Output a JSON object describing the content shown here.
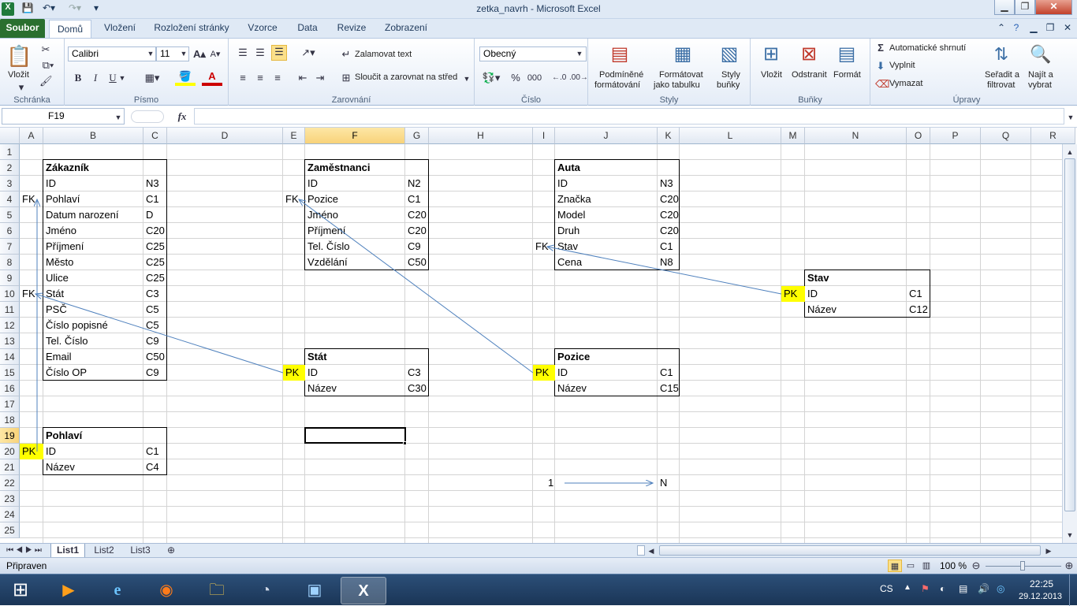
{
  "window": {
    "title": "zetka_navrh  -  Microsoft Excel"
  },
  "quick_access": {
    "app_icon": "excel-icon",
    "save_icon": "save-icon",
    "undo_icon": "undo-icon",
    "redo_icon": "redo-icon"
  },
  "tabs": [
    "Soubor",
    "Domů",
    "Vložení",
    "Rozložení stránky",
    "Vzorce",
    "Data",
    "Revize",
    "Zobrazení"
  ],
  "active_tab": "Domů",
  "ribbon": {
    "clipboard": {
      "paste": "Vložit",
      "group": "Schránka"
    },
    "font": {
      "name": "Calibri",
      "size": "11",
      "bold": "B",
      "italic": "I",
      "underline": "U",
      "group": "Písmo"
    },
    "alignment": {
      "wrap": "Zalamovat text",
      "merge": "Sloučit a zarovnat na střed",
      "group": "Zarovnání"
    },
    "number": {
      "format": "Obecný",
      "percent": "%",
      "thousands": "000",
      "group": "Číslo"
    },
    "styles": {
      "conditional_1": "Podmíněné",
      "conditional_2": "formátování",
      "table_1": "Formátovat",
      "table_2": "jako tabulku",
      "cell_1": "Styly",
      "cell_2": "buňky",
      "group": "Styly"
    },
    "cells": {
      "insert": "Vložit",
      "delete": "Odstranit",
      "format": "Formát",
      "group": "Buňky"
    },
    "editing": {
      "autosum": "Automatické shrnutí",
      "fill": "Vyplnit",
      "clear": "Vymazat",
      "sort_1": "Seřadit a",
      "sort_2": "filtrovat",
      "find_1": "Najít a",
      "find_2": "vybrat",
      "group": "Úpravy"
    }
  },
  "formula_bar": {
    "name_box": "F19",
    "fx": "fx",
    "value": ""
  },
  "columns": [
    "A",
    "B",
    "C",
    "D",
    "E",
    "F",
    "G",
    "H",
    "I",
    "J",
    "K",
    "L",
    "M",
    "N",
    "O",
    "P",
    "Q",
    "R"
  ],
  "rows": [
    "1",
    "2",
    "3",
    "4",
    "5",
    "6",
    "7",
    "8",
    "9",
    "10",
    "11",
    "12",
    "13",
    "14",
    "15",
    "16",
    "17",
    "18",
    "19",
    "20",
    "21",
    "22",
    "23",
    "24",
    "25"
  ],
  "selected_cell": {
    "column": "F",
    "row": "19"
  },
  "tables": {
    "zakaznik": {
      "title": "Zákazník",
      "rows": [
        {
          "key": "",
          "name": "ID",
          "type": "N3"
        },
        {
          "key": "FK",
          "name": "Pohlaví",
          "type": "C1"
        },
        {
          "key": "",
          "name": "Datum narození",
          "type": "D"
        },
        {
          "key": "",
          "name": "Jméno",
          "type": "C20"
        },
        {
          "key": "",
          "name": "Příjmení",
          "type": "C25"
        },
        {
          "key": "",
          "name": "Město",
          "type": "C25"
        },
        {
          "key": "",
          "name": "Ulice",
          "type": "C25"
        },
        {
          "key": "FK",
          "name": "Stát",
          "type": "C3"
        },
        {
          "key": "",
          "name": "PSČ",
          "type": "C5"
        },
        {
          "key": "",
          "name": "Číslo popisné",
          "type": "C5"
        },
        {
          "key": "",
          "name": "Tel. Číslo",
          "type": "C9"
        },
        {
          "key": "",
          "name": "Email",
          "type": "C50"
        },
        {
          "key": "",
          "name": "Číslo OP",
          "type": "C9"
        }
      ]
    },
    "zamestnanci": {
      "title": "Zaměstnanci",
      "rows": [
        {
          "key": "",
          "name": "ID",
          "type": "N2"
        },
        {
          "key": "FK",
          "name": "Pozice",
          "type": "C1"
        },
        {
          "key": "",
          "name": "Jméno",
          "type": "C20"
        },
        {
          "key": "",
          "name": "Příjmení",
          "type": "C20"
        },
        {
          "key": "",
          "name": "Tel. Číslo",
          "type": "C9"
        },
        {
          "key": "",
          "name": "Vzdělání",
          "type": "C50"
        }
      ]
    },
    "auta": {
      "title": "Auta",
      "rows": [
        {
          "key": "",
          "name": "ID",
          "type": "N3"
        },
        {
          "key": "",
          "name": "Značka",
          "type": "C20"
        },
        {
          "key": "",
          "name": "Model",
          "type": "C20"
        },
        {
          "key": "",
          "name": "Druh",
          "type": "C20"
        },
        {
          "key": "FK",
          "name": "Stav",
          "type": "C1"
        },
        {
          "key": "",
          "name": "Cena",
          "type": "N8"
        }
      ]
    },
    "stav": {
      "title": "Stav",
      "rows": [
        {
          "key": "PK",
          "name": "ID",
          "type": "C1"
        },
        {
          "key": "",
          "name": "Název",
          "type": "C12"
        }
      ]
    },
    "stat": {
      "title": "Stát",
      "rows": [
        {
          "key": "PK",
          "name": "ID",
          "type": "C3"
        },
        {
          "key": "",
          "name": "Název",
          "type": "C30"
        }
      ]
    },
    "pozice": {
      "title": "Pozice",
      "rows": [
        {
          "key": "PK",
          "name": "ID",
          "type": "C1"
        },
        {
          "key": "",
          "name": "Název",
          "type": "C15"
        }
      ]
    },
    "pohlavi": {
      "title": "Pohlaví",
      "rows": [
        {
          "key": "PK",
          "name": "ID",
          "type": "C1"
        },
        {
          "key": "",
          "name": "Název",
          "type": "C4"
        }
      ]
    }
  },
  "legend": {
    "left": "1",
    "right": "N"
  },
  "sheet_tabs": [
    "List1",
    "List2",
    "List3"
  ],
  "active_sheet": "List1",
  "status": {
    "ready": "Připraven",
    "zoom": "100 %"
  },
  "taskbar": {
    "lang": "CS",
    "time": "22:25",
    "date": "29.12.2013"
  },
  "colors": {
    "pk_highlight": "#ffff00",
    "arrow": "#4f81bd",
    "selected_header": "#f8d37a",
    "soubor_tab": "#2a6f2f"
  }
}
